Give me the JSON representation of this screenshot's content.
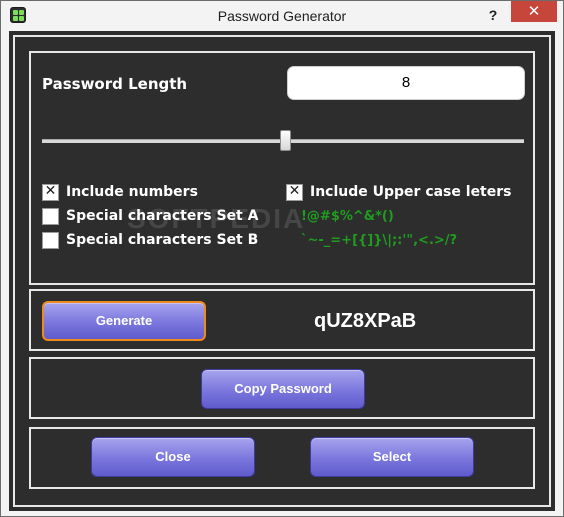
{
  "window": {
    "title": "Password Generator",
    "help_label": "?",
    "close_label": "✕"
  },
  "settings": {
    "length_label": "Password Length",
    "length_value": "8",
    "slider_level": 0.5,
    "include_numbers": {
      "label": "Include numbers",
      "checked": true
    },
    "include_upper": {
      "label": "Include Upper case leters",
      "checked": true
    },
    "special_a": {
      "label": "Special characters Set A",
      "checked": false,
      "chars": "!@#$%^&*()"
    },
    "special_b": {
      "label": "Special characters Set B",
      "checked": false,
      "chars": "`~-_=+[{]}\\|;:'\",<.>/?"
    }
  },
  "generate": {
    "button_label": "Generate",
    "result": "qUZ8XPaB"
  },
  "copy": {
    "button_label": "Copy Password"
  },
  "footer": {
    "close_label": "Close",
    "select_label": "Select"
  },
  "watermark": "SOFTPEDIA",
  "colors": {
    "background": "#2d2d2d",
    "frame": "#e8e8e8",
    "button": "#7a76dd",
    "focus": "#ef8a1c",
    "charset_text": "#1f9d1f",
    "titlebar_close": "#c7463b"
  }
}
